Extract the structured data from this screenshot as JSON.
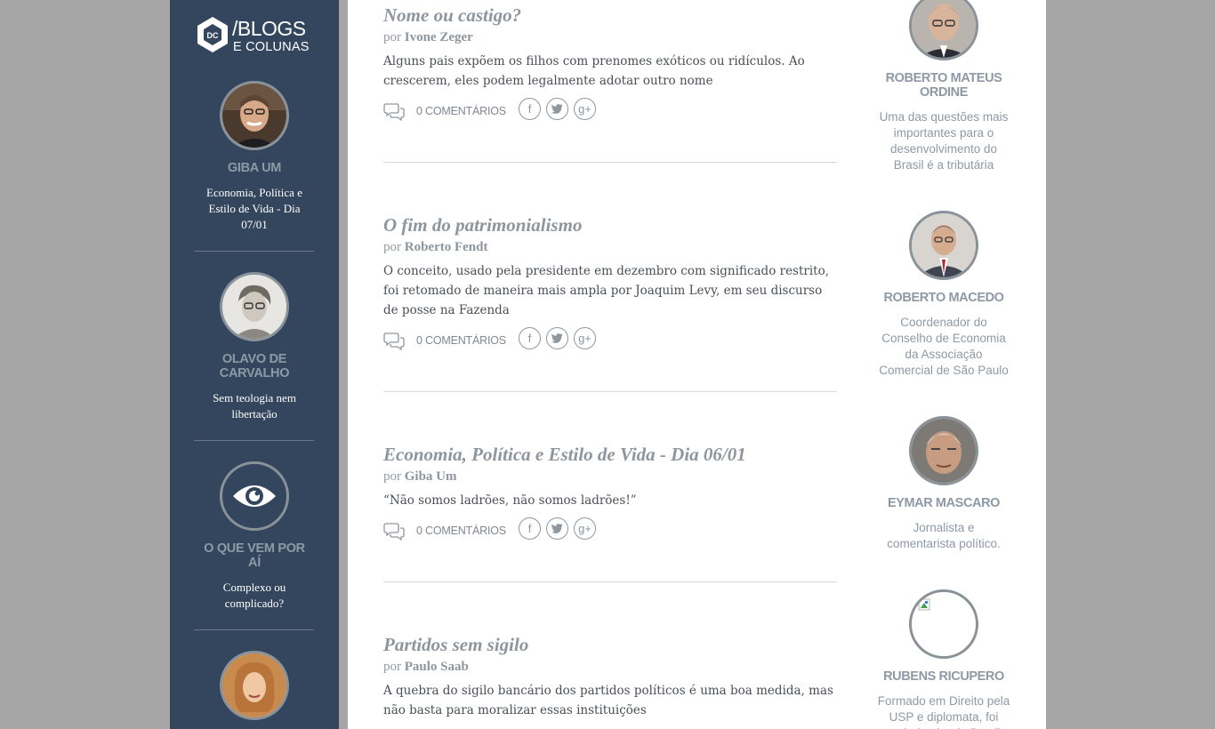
{
  "logo": {
    "mark": "DC",
    "line1": "/BLOGS",
    "line2": "E COLUNAS"
  },
  "sidebar": {
    "items": [
      {
        "name": "GIBA UM",
        "description": "Economia, Política e Estilo de Vida - Dia 07/01",
        "avatar": "portrait"
      },
      {
        "name": "OLAVO DE CARVALHO",
        "description": "Sem teologia nem libertação",
        "avatar": "portrait"
      },
      {
        "name": "O QUE VEM POR AÍ",
        "description": "Complexo ou complicado?",
        "avatar": "eye-icon"
      },
      {
        "name": "",
        "description": "",
        "avatar": "portrait"
      }
    ]
  },
  "posts": [
    {
      "title": "Nome ou castigo?",
      "by": "por",
      "author": "Ivone Zeger",
      "excerpt": "Alguns pais expõem os filhos com prenomes exóticos ou ridículos. Ao crescerem, eles podem legalmente adotar outro nome",
      "comments": "0 COMENTÁRIOS"
    },
    {
      "title": "O fim do patrimonialismo",
      "by": "por",
      "author": "Roberto Fendt",
      "excerpt": "O conceito, usado pela presidente em dezembro com significado restrito, foi retomado de maneira mais ampla por Joaquim Levy, em seu discurso de posse na Fazenda",
      "comments": "0 COMENTÁRIOS"
    },
    {
      "title": "Economia, Política e Estilo de Vida - Dia 06/01",
      "by": "por",
      "author": "Giba Um",
      "excerpt": "“Não somos ladrões, não somos ladrões!”",
      "comments": "0 COMENTÁRIOS"
    },
    {
      "title": "Partidos sem sigilo",
      "by": "por",
      "author": "Paulo Saab",
      "excerpt": "A quebra do sigilo bancário dos partidos políticos é uma boa medida, mas não basta para moralizar essas instituições",
      "comments": ""
    }
  ],
  "share": {
    "facebook": "f",
    "twitter": "twitter-bird-icon",
    "googleplus": "g+"
  },
  "columnists": [
    {
      "name": "ROBERTO MATEUS ORDINE",
      "description": "Uma das questões mais importantes para o desenvolvimento do Brasil é a tributária"
    },
    {
      "name": "ROBERTO MACEDO",
      "description": "Coordenador do Conselho de Economia da Associação Comercial de São Paulo"
    },
    {
      "name": "EYMAR MASCARO",
      "description": "Jornalista e comentarista político."
    },
    {
      "name": "RUBENS RICUPERO",
      "description": "Formado em Direito pela USP e diplomata, foi embaixador do Brasil"
    }
  ],
  "colors": {
    "sidebar_bg": "#34465d",
    "page_bg": "#a6a6a6",
    "muted_text": "#8e99a6",
    "title_text": "#8d959d",
    "body_text": "#4a4f55"
  }
}
